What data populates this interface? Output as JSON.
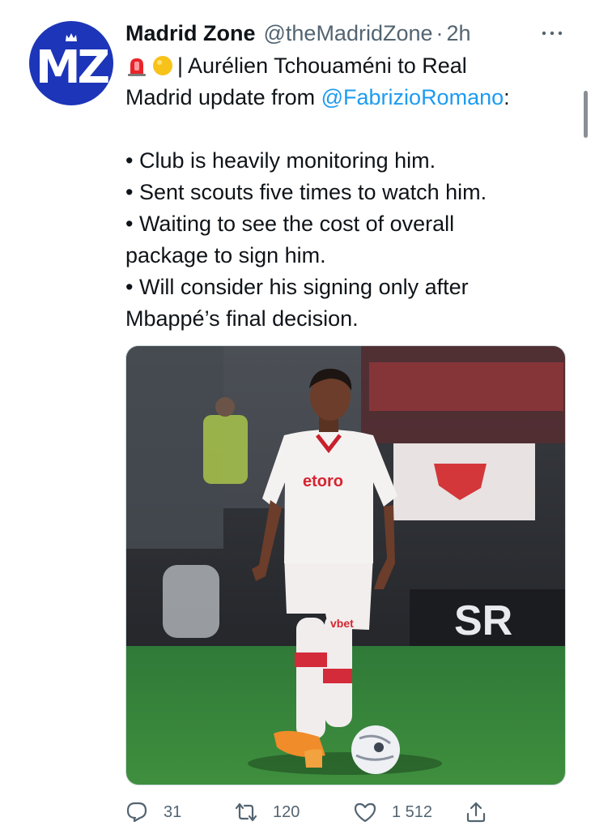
{
  "tweet": {
    "author": {
      "name": "Madrid Zone",
      "handle": "@theMadridZone",
      "separator": "·",
      "time": "2h",
      "avatar_text": "MZ",
      "avatar_color": "#1d35b8"
    },
    "text": {
      "line1_emojis": [
        "police-light-emoji",
        "yellow-circle-emoji"
      ],
      "line1": "| Aurélien Tchouaméni to Real",
      "line2_prefix": "Madrid update from ",
      "mention": "@FabrizioRomano",
      "line2_suffix": ":",
      "bullets": [
        "• Club is heavily monitoring him.",
        "• Sent scouts five times to watch him.",
        "• Waiting to see the cost of overall",
        "package to sign him.",
        "• Will consider his signing only after",
        "Mbappé’s final decision."
      ]
    },
    "media": {
      "jersey_sponsor": "etoro",
      "shorts_sponsor": "vbet",
      "board_text": "SR"
    },
    "actions": {
      "reply_count": "31",
      "retweet_count": "120",
      "like_count": "1 512"
    },
    "colors": {
      "text": "#0f1419",
      "secondary": "#536471",
      "link": "#1d9bf0"
    }
  }
}
